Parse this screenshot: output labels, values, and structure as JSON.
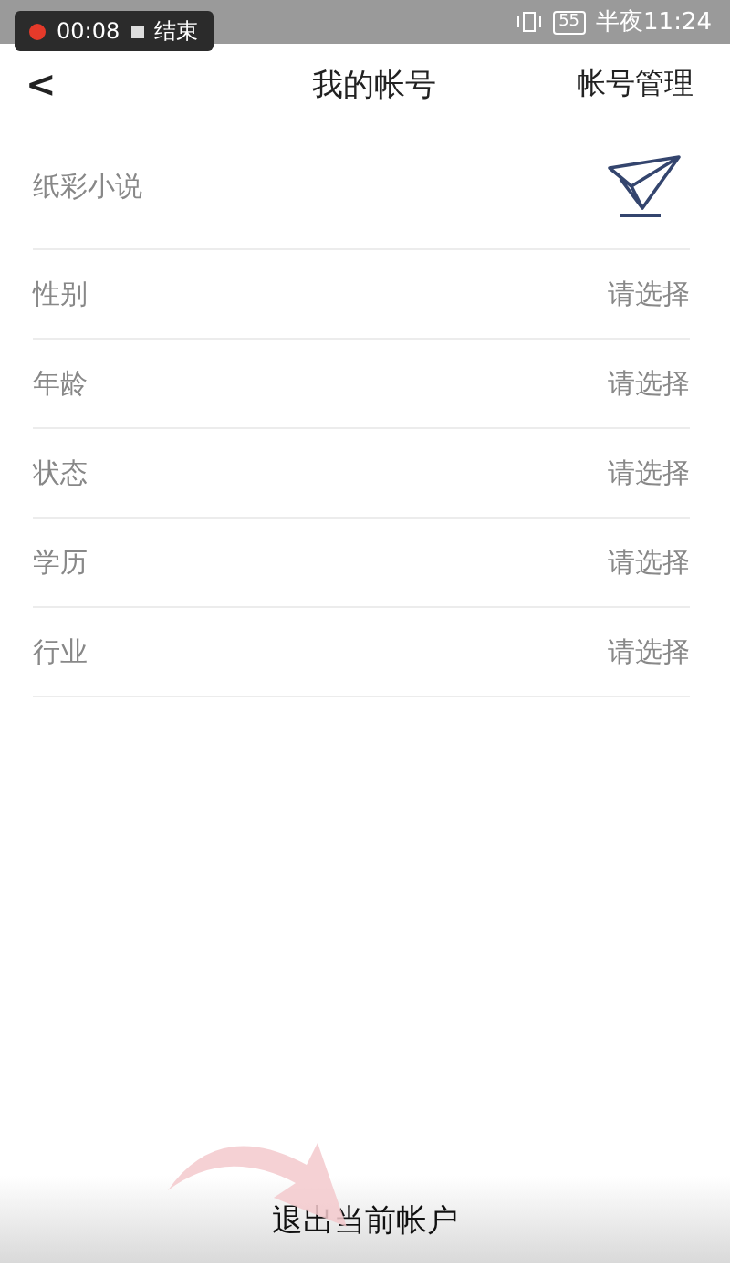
{
  "status_bar": {
    "recording": {
      "time": "00:08",
      "stop_label": "结束"
    },
    "battery": "55",
    "time": "半夜11:24"
  },
  "header": {
    "back": "<",
    "title": "我的帐号",
    "action": "帐号管理"
  },
  "profile": {
    "name": "纸彩小说"
  },
  "fields": [
    {
      "label": "性别",
      "value": "请选择"
    },
    {
      "label": "年龄",
      "value": "请选择"
    },
    {
      "label": "状态",
      "value": "请选择"
    },
    {
      "label": "学历",
      "value": "请选择"
    },
    {
      "label": "行业",
      "value": "请选择"
    }
  ],
  "logout_button": "退出当前帐户"
}
